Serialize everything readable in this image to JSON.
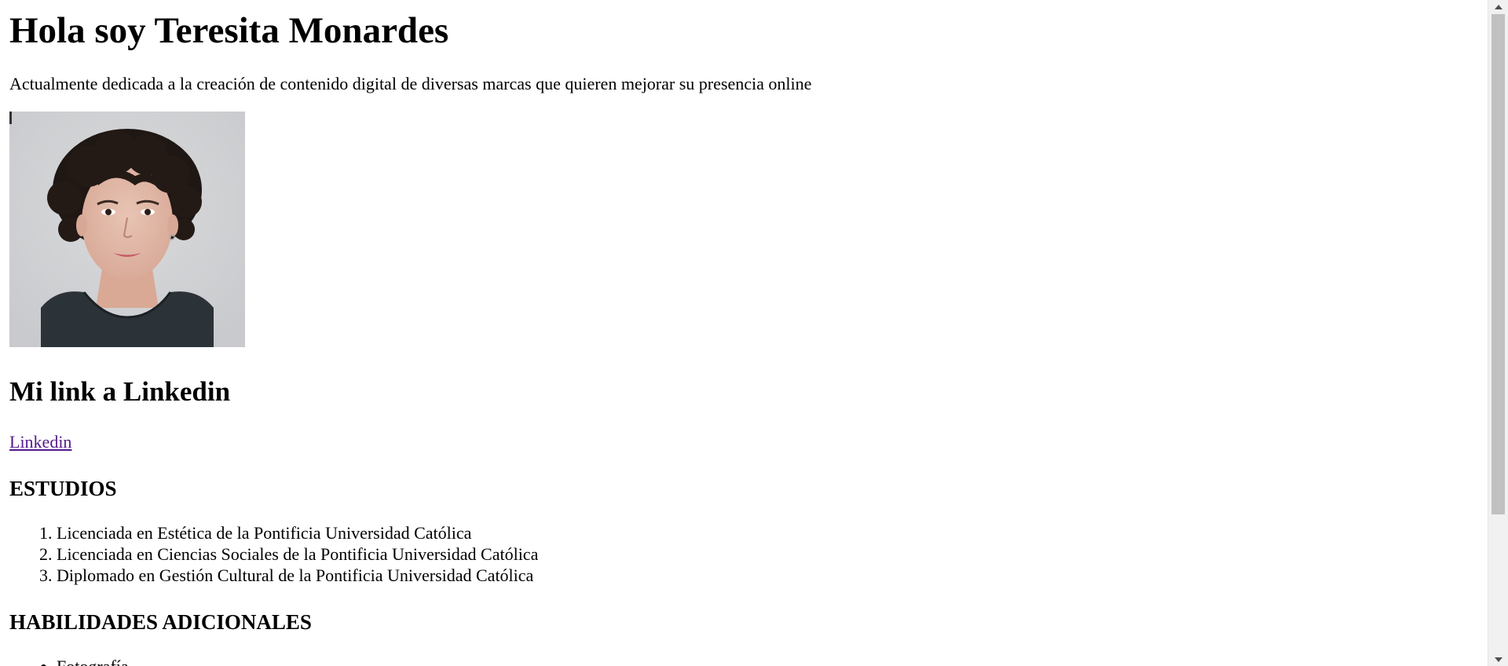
{
  "header": {
    "title": "Hola soy Teresita Monardes",
    "intro": "Actualmente dedicada a la creación de contenido digital de diversas marcas que quieren mejorar su presencia online"
  },
  "photo": {
    "alt": "Retrato de Teresita Monardes"
  },
  "linkedin": {
    "heading": "Mi link a Linkedin",
    "link_label": "Linkedin"
  },
  "studies": {
    "heading": "ESTUDIOS",
    "items": [
      "Licenciada en Estética de la Pontificia Universidad Católica",
      "Licenciada en Ciencias Sociales de la Pontificia Universidad Católica",
      "Diplomado en Gestión Cultural de la Pontificia Universidad Católica"
    ]
  },
  "skills": {
    "heading": "HABILIDADES ADICIONALES",
    "items": [
      "Fotografía"
    ]
  },
  "colors": {
    "link_visited": "#551a8b",
    "scrollbar_track": "#f1f1f1",
    "scrollbar_thumb": "#c1c1c1"
  }
}
